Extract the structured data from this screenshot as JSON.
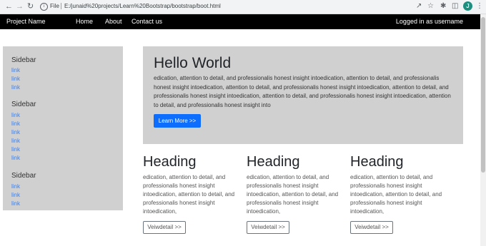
{
  "browser": {
    "back_icon": "arrow-left-icon",
    "forward_icon": "arrow-right-icon",
    "reload_icon": "reload-icon",
    "scheme": "File",
    "url": "E:/junaid%20projects/Learn%20Bootstrap/bootstrap/boot.html",
    "avatar_letter": "J"
  },
  "navbar": {
    "brand": "Project Name",
    "links": [
      "Home",
      "About",
      "Contact us"
    ],
    "login_text": "Logged in as username"
  },
  "sidebar": {
    "sections": [
      {
        "title": "Sidebar",
        "links": [
          "link",
          "link",
          "link"
        ]
      },
      {
        "title": "Sidebar",
        "links": [
          "link",
          "link",
          "link",
          "link",
          "link",
          "link"
        ]
      },
      {
        "title": "Sidebar",
        "links": [
          "link",
          "link",
          "link"
        ]
      }
    ]
  },
  "hero": {
    "title": "Hello World",
    "text": "edication, attention to detail, and professionalis honest insight intoedication, attention to detail, and professionalis honest insight intoedication, attention to detail, and professionalis honest insight intoedication, attention to detail, and professionalis honest insight intoedication, attention to detail, and professionalis honest insight intoedication, attention to detail, and professionalis honest insight into",
    "button_label": "Learn More >>"
  },
  "columns": [
    {
      "heading": "Heading",
      "text": "edication, attention to detail, and professionalis honest insight intoedication, attention to detail, and professionalis honest insight intoedication,",
      "button_label": "Veiwdetail >>"
    },
    {
      "heading": "Heading",
      "text": "edication, attention to detail, and professionalis honest insight intoedication, attention to detail, and professionalis honest insight intoedication,",
      "button_label": "Veiwdetail >>"
    },
    {
      "heading": "Heading",
      "text": "edication, attention to detail, and professionalis honest insight intoedication, attention to detail, and professionalis honest insight intoedication,",
      "button_label": "Veiwdetail >>"
    }
  ],
  "colors": {
    "navbar_bg": "#000000",
    "panel_bg": "#d0d0d0",
    "primary": "#0d6efd",
    "link": "#4a7fd6"
  }
}
